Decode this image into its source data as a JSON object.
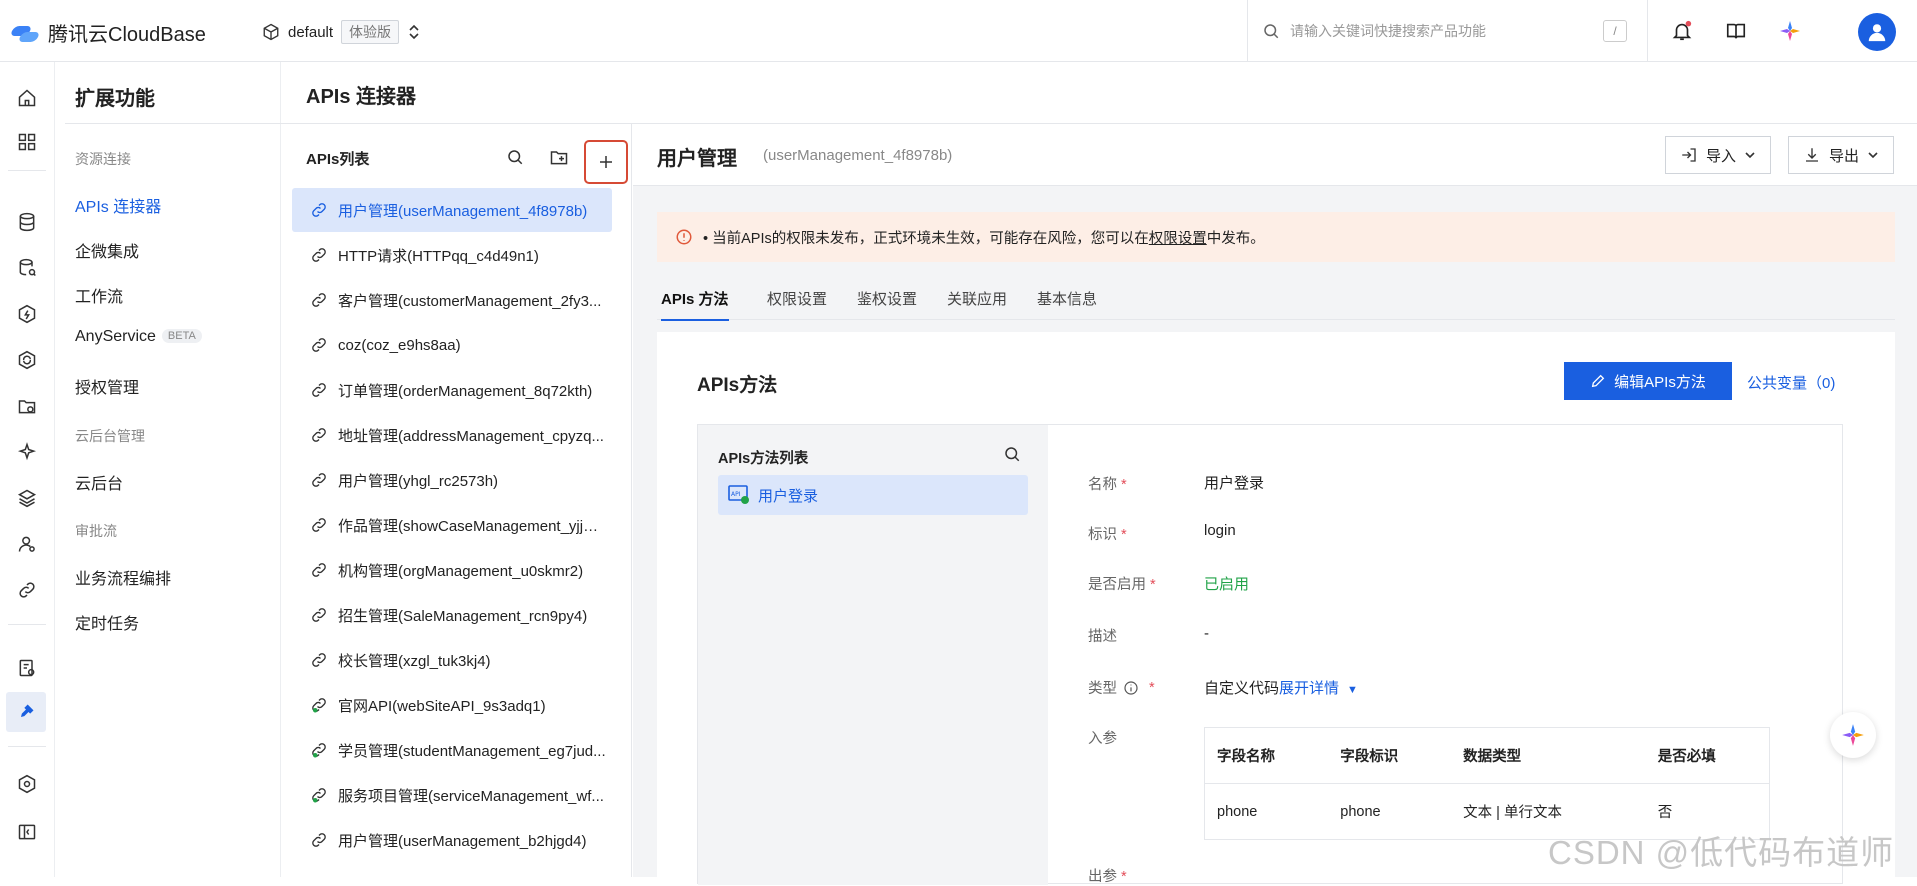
{
  "brand": {
    "name": "腾讯云CloudBase",
    "env_name": "default",
    "env_badge": "体验版"
  },
  "search": {
    "placeholder": "请输入关键词快捷搜索产品功能",
    "shortcut": "/"
  },
  "sidebar": {
    "title": "扩展功能",
    "groups": [
      {
        "label": "资源连接"
      },
      {
        "label": "云后台管理"
      },
      {
        "label": "审批流"
      }
    ],
    "items": [
      {
        "label": "APIs 连接器"
      },
      {
        "label": "企微集成"
      },
      {
        "label": "工作流"
      },
      {
        "label": "AnyService"
      },
      {
        "label": "授权管理"
      },
      {
        "label": "云后台"
      },
      {
        "label": "业务流程编排"
      },
      {
        "label": "定时任务"
      }
    ],
    "beta_badge": "BETA"
  },
  "page": {
    "title": "APIs 连接器"
  },
  "api_list": {
    "title": "APIs列表",
    "items": [
      "用户管理(userManagement_4f8978b)",
      "HTTP请求(HTTPqq_c4d49n1)",
      "客户管理(customerManagement_2fy3...",
      "coz(coz_e9hs8aa)",
      "订单管理(orderManagement_8q72kth)",
      "地址管理(addressManagement_cpyzq...",
      "用户管理(yhgl_rc2573h)",
      "作品管理(showCaseManagement_yjjm...",
      "机构管理(orgManagement_u0skmr2)",
      "招生管理(SaleManagement_rcn9py4)",
      "校长管理(xzgl_tuk3kj4)",
      "官网API(webSiteAPI_9s3adq1)",
      "学员管理(studentManagement_eg7jud...",
      "服务项目管理(serviceManagement_wf...",
      "用户管理(userManagement_b2hjgd4)"
    ]
  },
  "detail": {
    "name": "用户管理",
    "id": "(userManagement_4f8978b)",
    "import_label": "导入",
    "export_label": "导出",
    "alert": {
      "prefix": "• 当前APIs的权限未发布，正式环境未生效，可能存在风险，您可以在",
      "link": "权限设置",
      "suffix": "中发布。"
    },
    "tabs": [
      "APIs 方法",
      "权限设置",
      "鉴权设置",
      "关联应用",
      "基本信息"
    ],
    "section_title": "APIs方法",
    "edit_button": "编辑APIs方法",
    "public_vars": "公共变量（0)",
    "method_list_title": "APIs方法列表",
    "method_item": "用户登录",
    "fields": {
      "name_label": "名称",
      "name_value": "用户登录",
      "id_label": "标识",
      "id_value": "login",
      "enabled_label": "是否启用",
      "enabled_value": "已启用",
      "desc_label": "描述",
      "desc_value": "-",
      "type_label": "类型",
      "type_value": "自定义代码",
      "type_link": "展开详情",
      "input_label": "入参",
      "output_label": "出参"
    },
    "params": {
      "headers": [
        "字段名称",
        "字段标识",
        "数据类型",
        "是否必填"
      ],
      "rows": [
        [
          "phone",
          "phone",
          "文本 | 单行文本",
          "否"
        ]
      ]
    }
  },
  "watermark": "CSDN @低代码布道师",
  "colors": {
    "primary": "#1a5fe0",
    "alert_bg": "#fdeee6",
    "success": "#21a348",
    "highlight_border": "#d64a35"
  }
}
